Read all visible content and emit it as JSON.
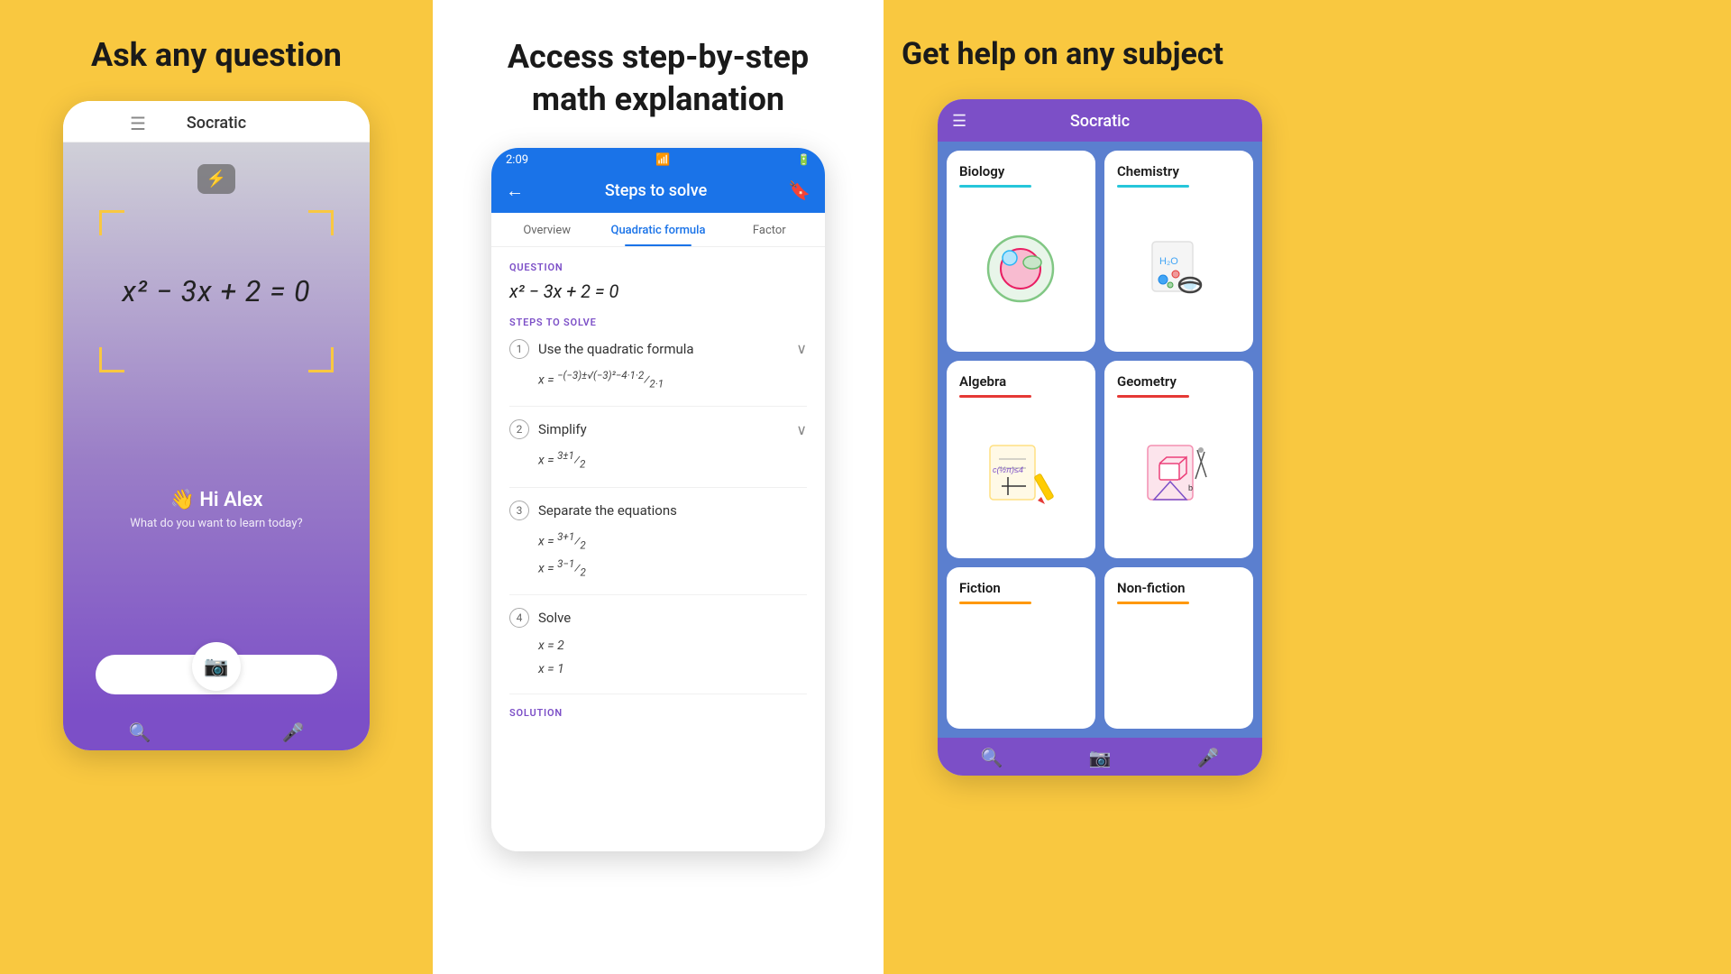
{
  "panel1": {
    "headline": "Ask any question",
    "app_title": "Socratic",
    "equation": "x² − 3x + 2 = 0",
    "greeting_emoji": "👋",
    "greeting_text": "Hi Alex",
    "sub_text": "What do you want to learn today?",
    "torch_icon": "🔦",
    "camera_icon": "📷",
    "search_icon": "🔍",
    "mic_icon": "🎤"
  },
  "panel2": {
    "headline": "Access step-by-step\nmath explanation",
    "status_time": "2:09",
    "header_title": "Steps to solve",
    "tabs": [
      {
        "label": "Overview",
        "active": false
      },
      {
        "label": "Quadratic formula",
        "active": true
      },
      {
        "label": "Factor",
        "active": false
      }
    ],
    "question_label": "QUESTION",
    "question_eq": "x² − 3x + 2 = 0",
    "steps_label": "STEPS TO SOLVE",
    "steps": [
      {
        "num": "1",
        "name": "Use the quadratic formula",
        "formula": "x = −(−3)±√(−3)²−4·1·2 / 2·1"
      },
      {
        "num": "2",
        "name": "Simplify",
        "formula": "x = 3±1 / 2"
      },
      {
        "num": "3",
        "name": "Separate the equations",
        "lines": [
          "x = 3+1/2",
          "x = 3−1/2"
        ]
      },
      {
        "num": "4",
        "name": "Solve",
        "lines": [
          "x = 2",
          "x = 1"
        ]
      }
    ],
    "solution_label": "SOLUTION"
  },
  "panel3": {
    "headline": "Get help on any subject",
    "app_title": "Socratic",
    "subjects": [
      {
        "title": "Biology",
        "underline": "teal"
      },
      {
        "title": "Chemistry",
        "underline": "teal"
      },
      {
        "title": "Algebra",
        "underline": "red"
      },
      {
        "title": "Geometry",
        "underline": "red"
      },
      {
        "title": "Fiction",
        "underline": "orange"
      },
      {
        "title": "Non-fiction",
        "underline": "orange"
      }
    ]
  }
}
